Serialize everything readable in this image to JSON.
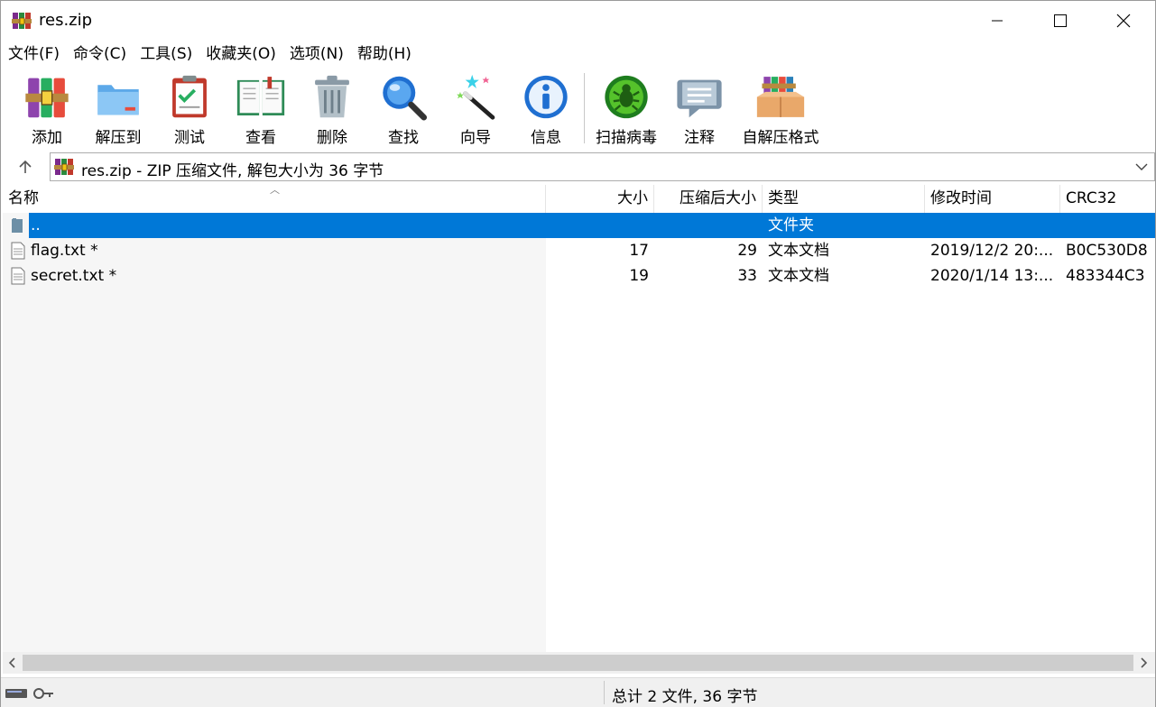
{
  "window": {
    "title": "res.zip",
    "app_icon": "winrar-books-icon"
  },
  "menubar": {
    "items": [
      "文件(F)",
      "命令(C)",
      "工具(S)",
      "收藏夹(O)",
      "选项(N)",
      "帮助(H)"
    ]
  },
  "toolbar": {
    "buttons": [
      {
        "label": "添加",
        "icon": "add-archive-icon"
      },
      {
        "label": "解压到",
        "icon": "extract-folder-icon"
      },
      {
        "label": "测试",
        "icon": "test-clipboard-icon"
      },
      {
        "label": "查看",
        "icon": "view-book-icon"
      },
      {
        "label": "删除",
        "icon": "trash-icon"
      },
      {
        "label": "查找",
        "icon": "magnifier-icon"
      },
      {
        "label": "向导",
        "icon": "wizard-wand-icon"
      },
      {
        "label": "信息",
        "icon": "info-icon"
      },
      {
        "label": "扫描病毒",
        "icon": "virus-scan-icon"
      },
      {
        "label": "注释",
        "icon": "comment-icon"
      },
      {
        "label": "自解压格式",
        "icon": "sfx-box-icon"
      }
    ]
  },
  "address": {
    "text": "res.zip - ZIP 压缩文件, 解包大小为 36 字节"
  },
  "filelist": {
    "columns": [
      "名称",
      "大小",
      "压缩后大小",
      "类型",
      "修改时间",
      "CRC32"
    ],
    "rows": [
      {
        "name": "..",
        "size": "",
        "packed": "",
        "type": "文件夹",
        "modified": "",
        "crc": "",
        "selected": true
      },
      {
        "name": "flag.txt *",
        "size": "17",
        "packed": "29",
        "type": "文本文档",
        "modified": "2019/12/2 20:...",
        "crc": "B0C530D8",
        "selected": false
      },
      {
        "name": "secret.txt *",
        "size": "19",
        "packed": "33",
        "type": "文本文档",
        "modified": "2020/1/14 13:...",
        "crc": "483344C3",
        "selected": false
      }
    ]
  },
  "status": {
    "text": "总计 2 文件, 36 字节"
  },
  "colors": {
    "selection": "#0078d7",
    "background": "#ffffff",
    "chrome": "#f0f0f0"
  }
}
